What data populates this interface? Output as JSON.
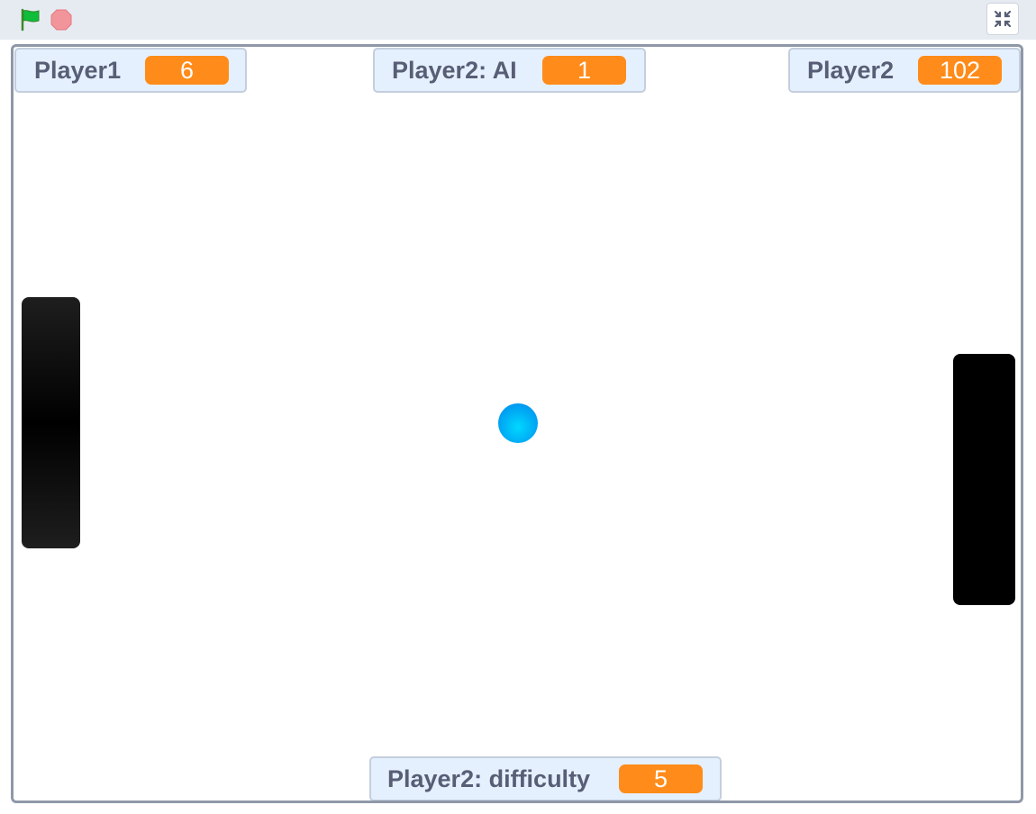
{
  "toolbar": {
    "icons": [
      "green-flag-icon",
      "stop-sign-icon",
      "exit-fullscreen-icon"
    ],
    "colors": {
      "flag": "#0fbd3a",
      "stop": "#ec5959",
      "bar_bg": "#e6ebf2"
    }
  },
  "monitors": {
    "player1": {
      "label": "Player1",
      "value": "6"
    },
    "player2_ai": {
      "label": "Player2: AI",
      "value": "1"
    },
    "player2": {
      "label": "Player2",
      "value": "102"
    },
    "player2_difficulty": {
      "label": "Player2: difficulty",
      "value": "5"
    }
  },
  "colors": {
    "monitor_value": "#ff8c1a",
    "monitor_label": "#575e75",
    "ball": "#00b4ff",
    "paddle": "#000000"
  }
}
